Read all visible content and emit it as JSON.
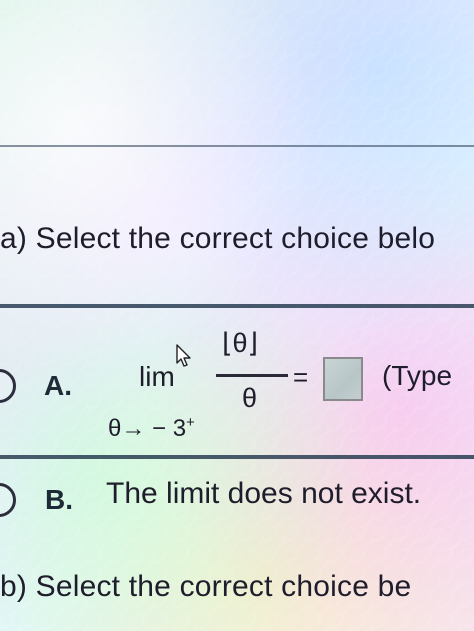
{
  "question_a": {
    "prompt": "a) Select the correct choice belo"
  },
  "option_a": {
    "label": "A.",
    "lim": "lim",
    "subscript": "θ→ − 3",
    "subscript_sup": "+",
    "numerator": "⌊θ⌋",
    "denominator": "θ",
    "equals": "=",
    "answer_value": "",
    "hint": "(Type"
  },
  "option_b": {
    "label": "B.",
    "text": "The limit does not exist."
  },
  "question_b": {
    "prompt": "b) Select the correct choice be"
  }
}
